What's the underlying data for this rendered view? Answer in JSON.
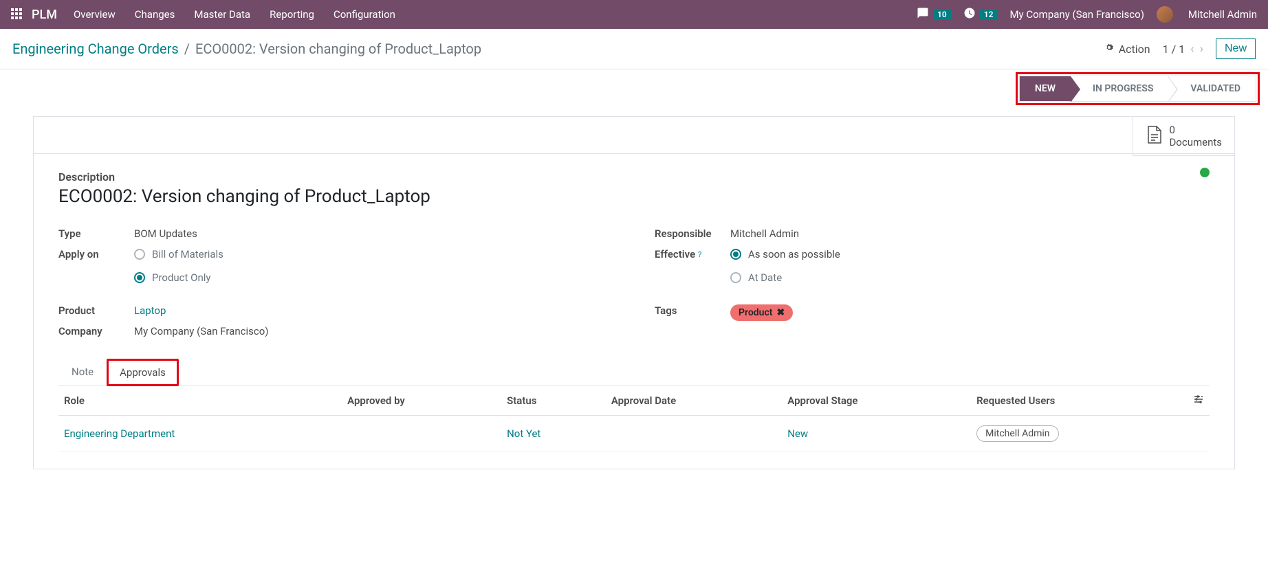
{
  "topbar": {
    "app_name": "PLM",
    "nav": [
      "Overview",
      "Changes",
      "Master Data",
      "Reporting",
      "Configuration"
    ],
    "chat_count": "10",
    "clock_count": "12",
    "company": "My Company (San Francisco)",
    "user": "Mitchell Admin"
  },
  "breadcrumb": {
    "parent": "Engineering Change Orders",
    "sep": "/",
    "current": "ECO0002: Version changing of Product_Laptop",
    "action_label": "Action",
    "pager": "1 / 1",
    "new_label": "New"
  },
  "statusbar": {
    "stages": [
      "NEW",
      "IN PROGRESS",
      "VALIDATED"
    ]
  },
  "doc_button": {
    "count": "0",
    "label": "Documents"
  },
  "form": {
    "desc_label": "Description",
    "desc_value": "ECO0002: Version changing of Product_Laptop",
    "type_label": "Type",
    "type_value": "BOM Updates",
    "apply_label": "Apply on",
    "apply_opts": [
      "Bill of Materials",
      "Product Only"
    ],
    "product_label": "Product",
    "product_value": "Laptop",
    "company_label": "Company",
    "company_value": "My Company (San Francisco)",
    "responsible_label": "Responsible",
    "responsible_value": "Mitchell Admin",
    "effective_label": "Effective",
    "effective_help": "?",
    "effective_opts": [
      "As soon as possible",
      "At Date"
    ],
    "tags_label": "Tags",
    "tag_value": "Product",
    "tag_x": "✖"
  },
  "tabs": {
    "note": "Note",
    "approvals": "Approvals"
  },
  "table": {
    "headers": [
      "Role",
      "Approved by",
      "Status",
      "Approval Date",
      "Approval Stage",
      "Requested Users"
    ],
    "row": {
      "role": "Engineering Department",
      "approved_by": "",
      "status": "Not Yet",
      "approval_date": "",
      "approval_stage": "New",
      "requested_user": "Mitchell Admin"
    }
  }
}
